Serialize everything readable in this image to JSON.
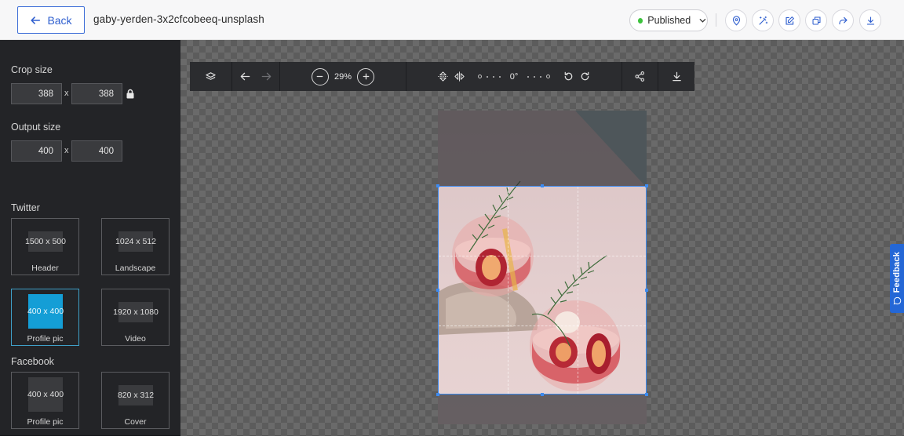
{
  "header": {
    "back_label": "Back",
    "file_title": "gaby-yerden-3x2cfcobeeq-unsplash",
    "status_label": "Published",
    "status_color": "#3cc23c",
    "accent": "#2f5fcf",
    "actions": [
      "location-icon",
      "magic-wand-icon",
      "edit-icon",
      "duplicate-icon",
      "share-icon",
      "download-icon"
    ]
  },
  "sidebar": {
    "crop_size": {
      "label": "Crop size",
      "width": "388",
      "height": "388",
      "sep": "x"
    },
    "output_size": {
      "label": "Output size",
      "width": "400",
      "height": "400",
      "sep": "x"
    },
    "twitter": {
      "label": "Twitter",
      "presets": [
        {
          "size": "1500 x 500",
          "name": "Header"
        },
        {
          "size": "1024 x 512",
          "name": "Landscape"
        },
        {
          "size": "400 x 400",
          "name": "Profile pic",
          "active": true
        },
        {
          "size": "1920 x 1080",
          "name": "Video"
        }
      ]
    },
    "facebook": {
      "label": "Facebook",
      "presets": [
        {
          "size": "400 x 400",
          "name": "Profile pic"
        },
        {
          "size": "820 x 312",
          "name": "Cover"
        }
      ]
    }
  },
  "toolbar": {
    "zoom": "29%",
    "rotation": "0°"
  },
  "feedback_label": "Feedback"
}
